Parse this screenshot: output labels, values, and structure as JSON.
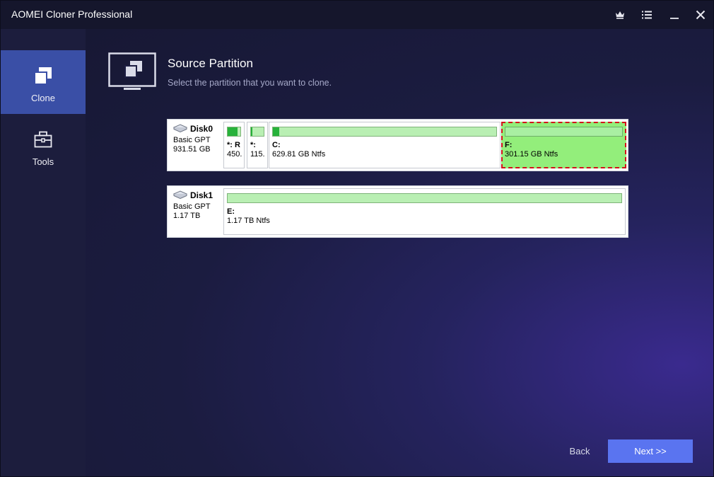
{
  "window": {
    "title": "AOMEI Cloner Professional"
  },
  "titlebar": {
    "icons": [
      "crown-icon",
      "menu-icon",
      "minimize-icon",
      "close-icon"
    ]
  },
  "sidebar": {
    "items": [
      {
        "label": "Clone",
        "icon": "clone-icon",
        "active": true
      },
      {
        "label": "Tools",
        "icon": "toolbox-icon",
        "active": false
      }
    ]
  },
  "header": {
    "title": "Source Partition",
    "subtitle": "Select the partition that you want to clone."
  },
  "disks": [
    {
      "name": "Disk0",
      "type": "Basic GPT",
      "size": "931.51 GB",
      "partitions": [
        {
          "name": "*: R",
          "info": "450.",
          "used": 0.8
        },
        {
          "name": "*:",
          "info": "115.",
          "used": 0.1
        },
        {
          "name": "C:",
          "info": "629.81 GB Ntfs",
          "used": 0.03
        },
        {
          "name": "F:",
          "info": "301.15 GB Ntfs",
          "used": 0.0,
          "selected": true
        }
      ]
    },
    {
      "name": "Disk1",
      "type": "Basic GPT",
      "size": "1.17 TB",
      "partitions": [
        {
          "name": "E:",
          "info": "1.17 TB Ntfs",
          "used": 0.0
        }
      ]
    }
  ],
  "buttons": {
    "back": "Back",
    "next": "Next >>"
  },
  "colors": {
    "accent": "#5a74f0",
    "sidebar_active": "#3a4fa6",
    "selected_partition": "#93ee7b",
    "selection_border": "#d3131a",
    "usage_fill": "#27b23a"
  }
}
